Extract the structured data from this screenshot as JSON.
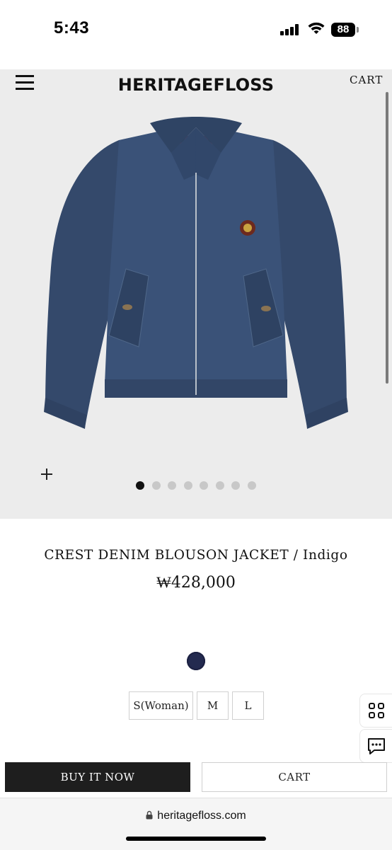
{
  "status_bar": {
    "time": "5:43",
    "battery": "88",
    "icons": [
      "signal-icon",
      "wifi-icon",
      "battery-icon"
    ]
  },
  "header": {
    "brand": "HERITAGEFLOSS",
    "cart_label": "CART",
    "menu_icon": "hamburger-menu-icon"
  },
  "gallery": {
    "image_count": 8,
    "active_index": 0,
    "zoom_icon": "plus-icon"
  },
  "product": {
    "name": "CREST DENIM BLOUSON JACKET / Indigo",
    "price": "₩428,000",
    "color_swatch": "#232a4f",
    "sizes": [
      "S(Woman)",
      "M",
      "L"
    ]
  },
  "side_actions": {
    "icons": [
      "grid-icon",
      "chat-icon"
    ]
  },
  "actions": {
    "buy_now": "BUY IT NOW",
    "cart": "CART"
  },
  "browser": {
    "url": "heritagefloss.com",
    "lock_icon": "lock-icon"
  },
  "colors": {
    "gallery_bg": "#ececec",
    "buy_button_bg": "#1e1e1e",
    "denim": "#3a5278",
    "active_dot": "#111111",
    "inactive_dot": "#c8c8c8"
  }
}
